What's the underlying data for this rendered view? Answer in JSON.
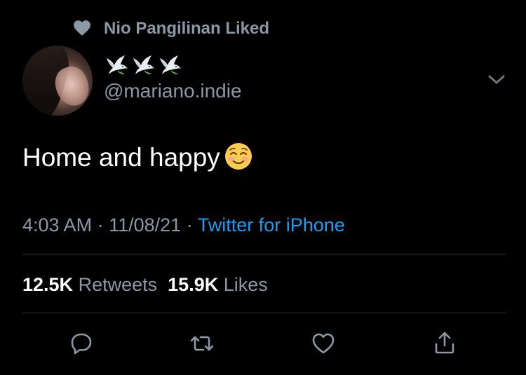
{
  "context": {
    "label": "Nio Pangilinan Liked",
    "icon": "heart-icon"
  },
  "author": {
    "display_name_icons": [
      "dove-emoji",
      "dove-emoji",
      "dove-emoji"
    ],
    "handle": "@mariano.indie"
  },
  "tweet": {
    "text": "Home and happy",
    "emoji": "smiling-face-emoji"
  },
  "meta": {
    "time": "4:03 AM",
    "separator": " · ",
    "date": "11/08/21",
    "source": "Twitter for iPhone"
  },
  "stats": {
    "retweets_count": "12.5K",
    "retweets_label": "Retweets",
    "likes_count": "15.9K",
    "likes_label": "Likes"
  },
  "actions": [
    "reply-icon",
    "retweet-icon",
    "like-icon",
    "share-icon"
  ],
  "colors": {
    "background": "#000000",
    "text": "#ffffff",
    "secondary": "#8b98a5",
    "link": "#1d9bf0",
    "divider": "#2f3336"
  }
}
